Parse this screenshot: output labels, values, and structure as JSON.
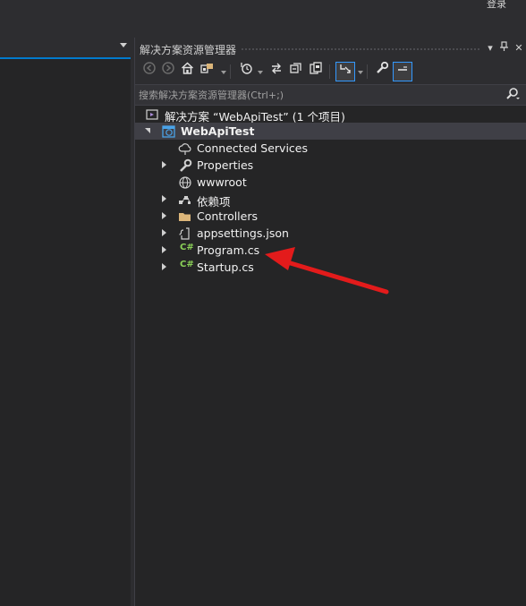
{
  "topbar": {
    "stub_text": "登录"
  },
  "panel": {
    "title": "解决方案资源管理器",
    "search_placeholder": "搜索解决方案资源管理器(Ctrl+;)",
    "title_buttons": [
      "pin-dropdown",
      "pin",
      "close"
    ]
  },
  "toolbar": {
    "buttons": [
      "back-icon",
      "forward-icon",
      "home-icon",
      "switch-views-icon",
      "pending-changes-icon",
      "sync-icon",
      "collapse-all-icon",
      "show-all-files-icon",
      "sync-with-active-doc-icon",
      "properties-icon",
      "preview-icon"
    ]
  },
  "tree": {
    "solution": "解决方案 “WebApiTest” (1 个项目)",
    "project": "WebApiTest",
    "items": [
      {
        "label": "Connected Services",
        "icon": "cloud-icon",
        "expandable": false
      },
      {
        "label": "Properties",
        "icon": "wrench-icon",
        "expandable": true
      },
      {
        "label": "wwwroot",
        "icon": "globe-icon",
        "expandable": false
      },
      {
        "label": "依赖项",
        "icon": "dependencies-icon",
        "expandable": true
      },
      {
        "label": "Controllers",
        "icon": "folder-icon",
        "expandable": true
      },
      {
        "label": "appsettings.json",
        "icon": "json-icon",
        "expandable": true
      },
      {
        "label": "Program.cs",
        "icon": "csharp-file-icon",
        "expandable": true
      },
      {
        "label": "Startup.cs",
        "icon": "csharp-file-icon",
        "expandable": true
      }
    ]
  },
  "annotation": {
    "color": "#e31b1b",
    "points_to": "Program.cs"
  },
  "colors": {
    "accent": "#007acc",
    "selection": "#3f3f46",
    "csharp": "#8bd158",
    "folder": "#dcb67a"
  }
}
